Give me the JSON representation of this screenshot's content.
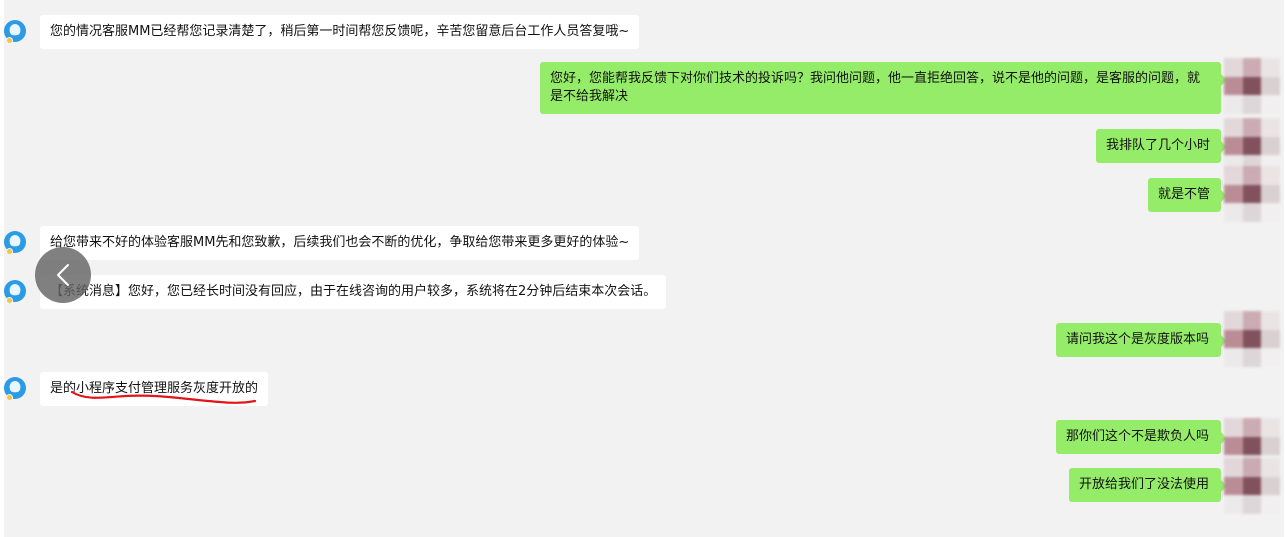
{
  "colors": {
    "chat_background": "#f2f2f2",
    "service_bubble": "#ffffff",
    "user_bubble": "#95ec69",
    "annotation_red": "#e0161b",
    "service_avatar": "#2b9be5"
  },
  "icons": {
    "service_avatar": "customer-service-avatar-icon",
    "user_avatar": "pixelated-user-avatar",
    "back": "chevron-left-icon"
  },
  "messages": [
    {
      "side": "left",
      "text": "您的情况客服MM已经帮您记录清楚了，稍后第一时间帮您反馈呢，辛苦您留意后台工作人员答复哦~"
    },
    {
      "side": "right",
      "text": "您好，您能帮我反馈下对你们技术的投诉吗？我问他问题，他一直拒绝回答，说不是他的问题，是客服的问题，就是不给我解决"
    },
    {
      "side": "right",
      "text": "我排队了几个小时"
    },
    {
      "side": "right",
      "text": "就是不管"
    },
    {
      "side": "left",
      "text": "给您带来不好的体验客服MM先和您致歉，后续我们也会不断的优化，争取给您带来更多更好的体验~"
    },
    {
      "side": "left",
      "text": "【系统消息】您好，您已经长时间没有回应，由于在线咨询的用户较多，系统将在2分钟后结束本次会话。"
    },
    {
      "side": "right",
      "text": "请问我这个是灰度版本吗"
    },
    {
      "side": "left",
      "text": "是的小程序支付管理服务灰度开放的"
    },
    {
      "side": "right",
      "text": "那你们这个不是欺负人吗"
    },
    {
      "side": "right",
      "text": "开放给我们了没法使用"
    }
  ]
}
